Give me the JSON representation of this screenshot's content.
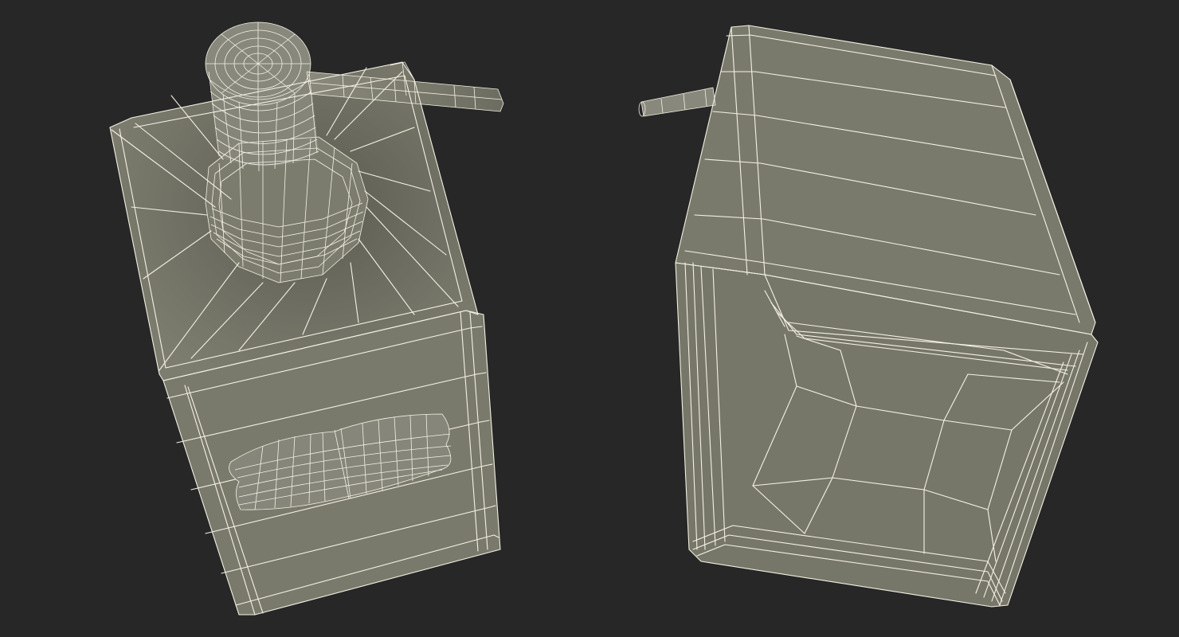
{
  "scene": {
    "background": "#272727",
    "mesh_fill": "#7a7a6c",
    "mesh_shadow": "#5f5f55",
    "wire_color": "#f4f1e4",
    "models": [
      {
        "view": "pump-bottle-top-view"
      },
      {
        "view": "pump-bottle-bottom-view"
      }
    ]
  }
}
